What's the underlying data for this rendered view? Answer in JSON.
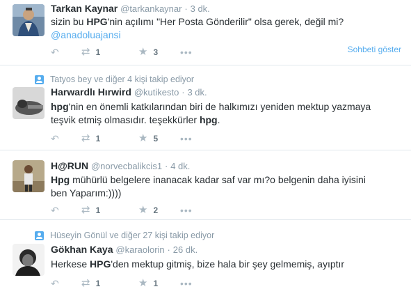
{
  "icons": {
    "reply": "↶",
    "retweet": "⇄",
    "favorite": "★",
    "more": "•••"
  },
  "tweets": [
    {
      "context": "",
      "fullname": "Tarkan Kaynar",
      "username": "@tarkankaynar",
      "dot": "·",
      "time": "3 dk.",
      "text_parts": [
        "sizin bu ",
        "HPG",
        "'nin açılımı \"Her Posta Gönderilir\" olsa gerek, değil mi?"
      ],
      "mention": "@anadoluajansi",
      "retweets": "1",
      "favorites": "3",
      "expand": "Sohbeti göster"
    },
    {
      "context": "Tatyos bey ve diğer 4 kişi takip ediyor",
      "fullname": "Harwardlı Hırwird",
      "username": "@kutikesto",
      "dot": "·",
      "time": "3 dk.",
      "text_parts": [
        "hpg",
        "'nin en önemli katkılarından biri de halkımızı yeniden mektup yazmaya teşvik etmiş olmasıdır. teşekkürler ",
        "hpg",
        "."
      ],
      "retweets": "1",
      "favorites": "5"
    },
    {
      "context": "",
      "fullname": "H@RUN",
      "username": "@norvecbalikcis1",
      "dot": "·",
      "time": "4 dk.",
      "text_parts": [
        "Hpg",
        " mühürlü belgelere inanacak kadar saf var mı?o belgenin daha iyisini ben Yaparım:))))"
      ],
      "retweets": "1",
      "favorites": "2"
    },
    {
      "context": "Hüseyin Gönül ve diğer 27 kişi takip ediyor",
      "fullname": "Gökhan Kaya",
      "username": "@karaolorin",
      "dot": "·",
      "time": "26 dk.",
      "text_parts": [
        "Herkese ",
        "HPG",
        "'den mektup gitmiş, bize hala bir şey gelmemiş, ayıptır"
      ],
      "retweets": "1",
      "favorites": "1"
    }
  ]
}
